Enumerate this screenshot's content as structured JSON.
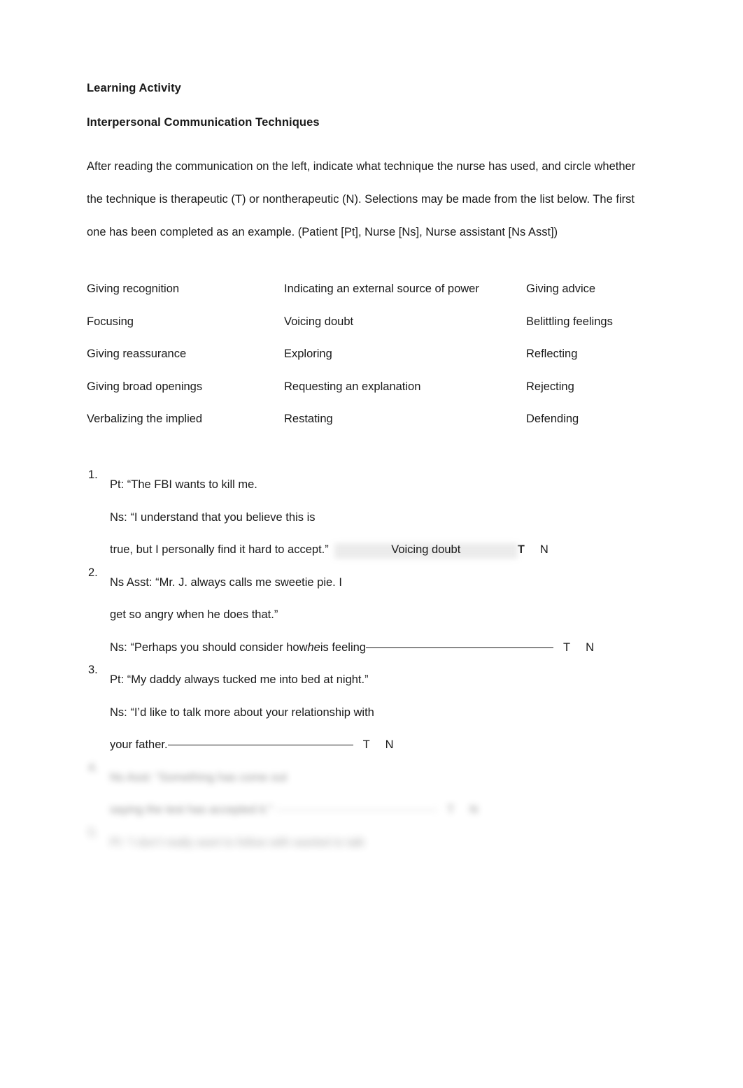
{
  "document": {
    "title": "Learning Activity",
    "subtitle": "Interpersonal Communication Techniques",
    "instructions": "After reading the communication on the left, indicate what technique the nurse has used, and circle whether the technique is therapeutic (T) or nontherapeutic (N). Selections may be made from the list below. The first one has been completed as an example. (Patient [Pt], Nurse [Ns], Nurse assistant [Ns Asst])"
  },
  "technique_list": {
    "rows": [
      {
        "col1": "Giving recognition",
        "col2": "Indicating an external source of power",
        "col3": "Giving advice"
      },
      {
        "col1": "Focusing",
        "col2": "Voicing doubt",
        "col3": "Belittling feelings"
      },
      {
        "col1": "Giving reassurance",
        "col2": "Exploring",
        "col3": "Reflecting"
      },
      {
        "col1": "Giving broad openings",
        "col2": "Requesting an explanation",
        "col3": "Rejecting"
      },
      {
        "col1": "Verbalizing the implied",
        "col2": "Restating",
        "col3": "Defending"
      }
    ]
  },
  "answer_options": {
    "therapeutic": "T",
    "nontherapeutic": "N"
  },
  "items": [
    {
      "number": "1.",
      "lines": [
        "Pt: “The FBI wants to kill me.",
        "Ns: “I understand that you believe this is"
      ],
      "final_line_prefix": "true, but I personally find it hard to accept.”",
      "answer_value": "Voicing doubt",
      "answer_filled": true,
      "selected": "T",
      "blurred": false
    },
    {
      "number": "2.",
      "lines": [
        "Ns Asst: “Mr. J. always calls me sweetie pie. I",
        "get so angry when he does that.”"
      ],
      "final_line_prefix": "Ns: “Perhaps you should consider how ",
      "final_line_italic": "he",
      "final_line_suffix": " is feeling",
      "answer_value": "",
      "answer_filled": false,
      "selected": "",
      "blurred": false
    },
    {
      "number": "3.",
      "lines": [
        "Pt: “My daddy always tucked me into bed at night.”",
        "Ns: “I’d like to talk more about your relationship with"
      ],
      "final_line_prefix": "your father.",
      "answer_value": "",
      "answer_filled": false,
      "selected": "",
      "blurred": false
    },
    {
      "number": "4.",
      "lines": [
        "Ns Asst: “Something has come out"
      ],
      "final_line_prefix": "saying the test has accepted it.”",
      "answer_value": "",
      "answer_filled": false,
      "selected": "",
      "blurred": true
    },
    {
      "number": "5.",
      "lines": [],
      "final_line_prefix": "Pt: “I don’t really want to follow with wanted to talk",
      "answer_value": "",
      "answer_filled": false,
      "selected": "",
      "blurred": true
    }
  ]
}
